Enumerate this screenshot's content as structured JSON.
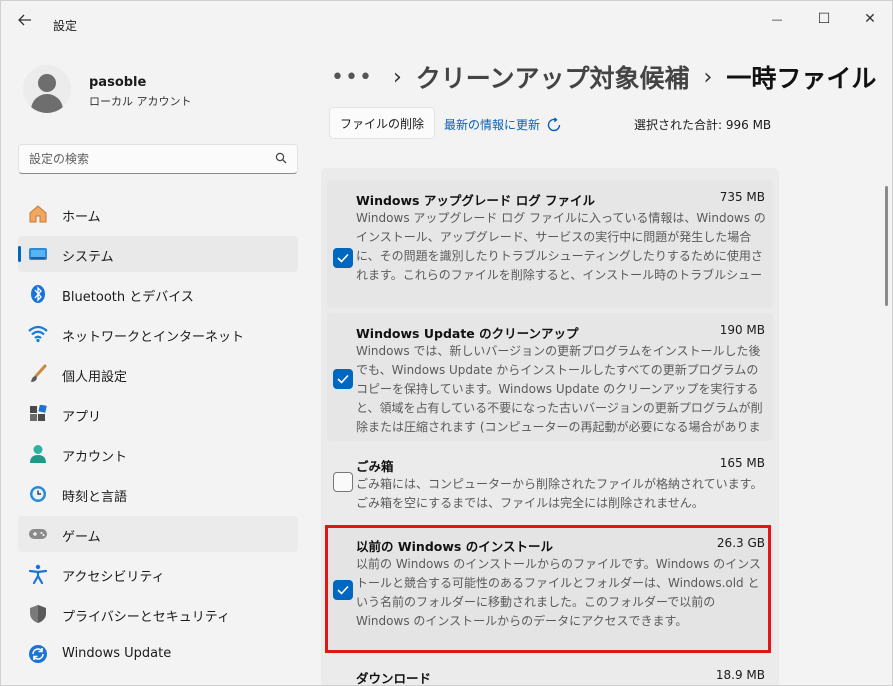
{
  "window": {
    "title": "設定",
    "controls": {
      "minimize": "—",
      "maximize": "☐",
      "close": "✕"
    }
  },
  "user": {
    "name": "pasoble",
    "account_type": "ローカル アカウント"
  },
  "search": {
    "placeholder": "設定の検索"
  },
  "nav": [
    {
      "label": "ホーム",
      "icon": "home-icon",
      "active": false
    },
    {
      "label": "システム",
      "icon": "system-icon",
      "active": true
    },
    {
      "label": "Bluetooth とデバイス",
      "icon": "bluetooth-icon",
      "active": false
    },
    {
      "label": "ネットワークとインターネット",
      "icon": "network-icon",
      "active": false
    },
    {
      "label": "個人用設定",
      "icon": "personalization-icon",
      "active": false
    },
    {
      "label": "アプリ",
      "icon": "apps-icon",
      "active": false
    },
    {
      "label": "アカウント",
      "icon": "accounts-icon",
      "active": false
    },
    {
      "label": "時刻と言語",
      "icon": "time-language-icon",
      "active": false
    },
    {
      "label": "ゲーム",
      "icon": "gaming-icon",
      "active": false
    },
    {
      "label": "アクセシビリティ",
      "icon": "accessibility-icon",
      "active": false
    },
    {
      "label": "プライバシーとセキュリティ",
      "icon": "privacy-icon",
      "active": false
    },
    {
      "label": "Windows Update",
      "icon": "windows-update-icon",
      "active": false
    }
  ],
  "breadcrumb": {
    "more": "•••",
    "sep": "›",
    "parent": "クリーンアップ対象候補",
    "current": "一時ファイル"
  },
  "actions": {
    "delete_label": "ファイルの削除",
    "refresh_label": "最新の情報に更新",
    "total_label": "選択された合計: 996 MB"
  },
  "items": [
    {
      "title": "Windows アップグレード ログ ファイル",
      "size": "735 MB",
      "checked": true,
      "desc": "Windows アップグレード ログ ファイルに入っている情報は、Windows のインストール、アップグレード、サービスの実行中に問題が発生した場合に、その問題を識別したりトラブルシューティングしたりするために使用されます。これらのファイルを削除すると、インストール時のトラブルシューティングが困難になりま"
    },
    {
      "title": "Windows Update のクリーンアップ",
      "size": "190 MB",
      "checked": true,
      "desc": "Windows では、新しいバージョンの更新プログラムをインストールした後でも、Windows Update からインストールしたすべての更新プログラムのコピーを保持しています。Windows Update のクリーンアップを実行すると、領域を占有している不要になった古いバージョンの更新プログラムが削除または圧縮されます (コンピューターの再起動が必要になる場合があります)。"
    },
    {
      "title": "ごみ箱",
      "size": "165 MB",
      "checked": false,
      "desc": "ごみ箱には、コンピューターから削除されたファイルが格納されています。ごみ箱を空にするまでは、ファイルは完全には削除されません。"
    },
    {
      "title": "以前の Windows のインストール",
      "size": "26.3 GB",
      "checked": true,
      "desc": "以前の Windows のインストールからのファイルです。Windows のインストールと競合する可能性のあるファイルとフォルダーは、Windows.old という名前のフォルダーに移動されました。このフォルダーで以前の Windows のインストールからのデータにアクセスできます。"
    },
    {
      "title": "ダウンロード",
      "size": "18.9 MB",
      "checked": false,
      "desc": ""
    }
  ],
  "colors": {
    "accent": "#0067c0",
    "highlight": "#e01515"
  }
}
